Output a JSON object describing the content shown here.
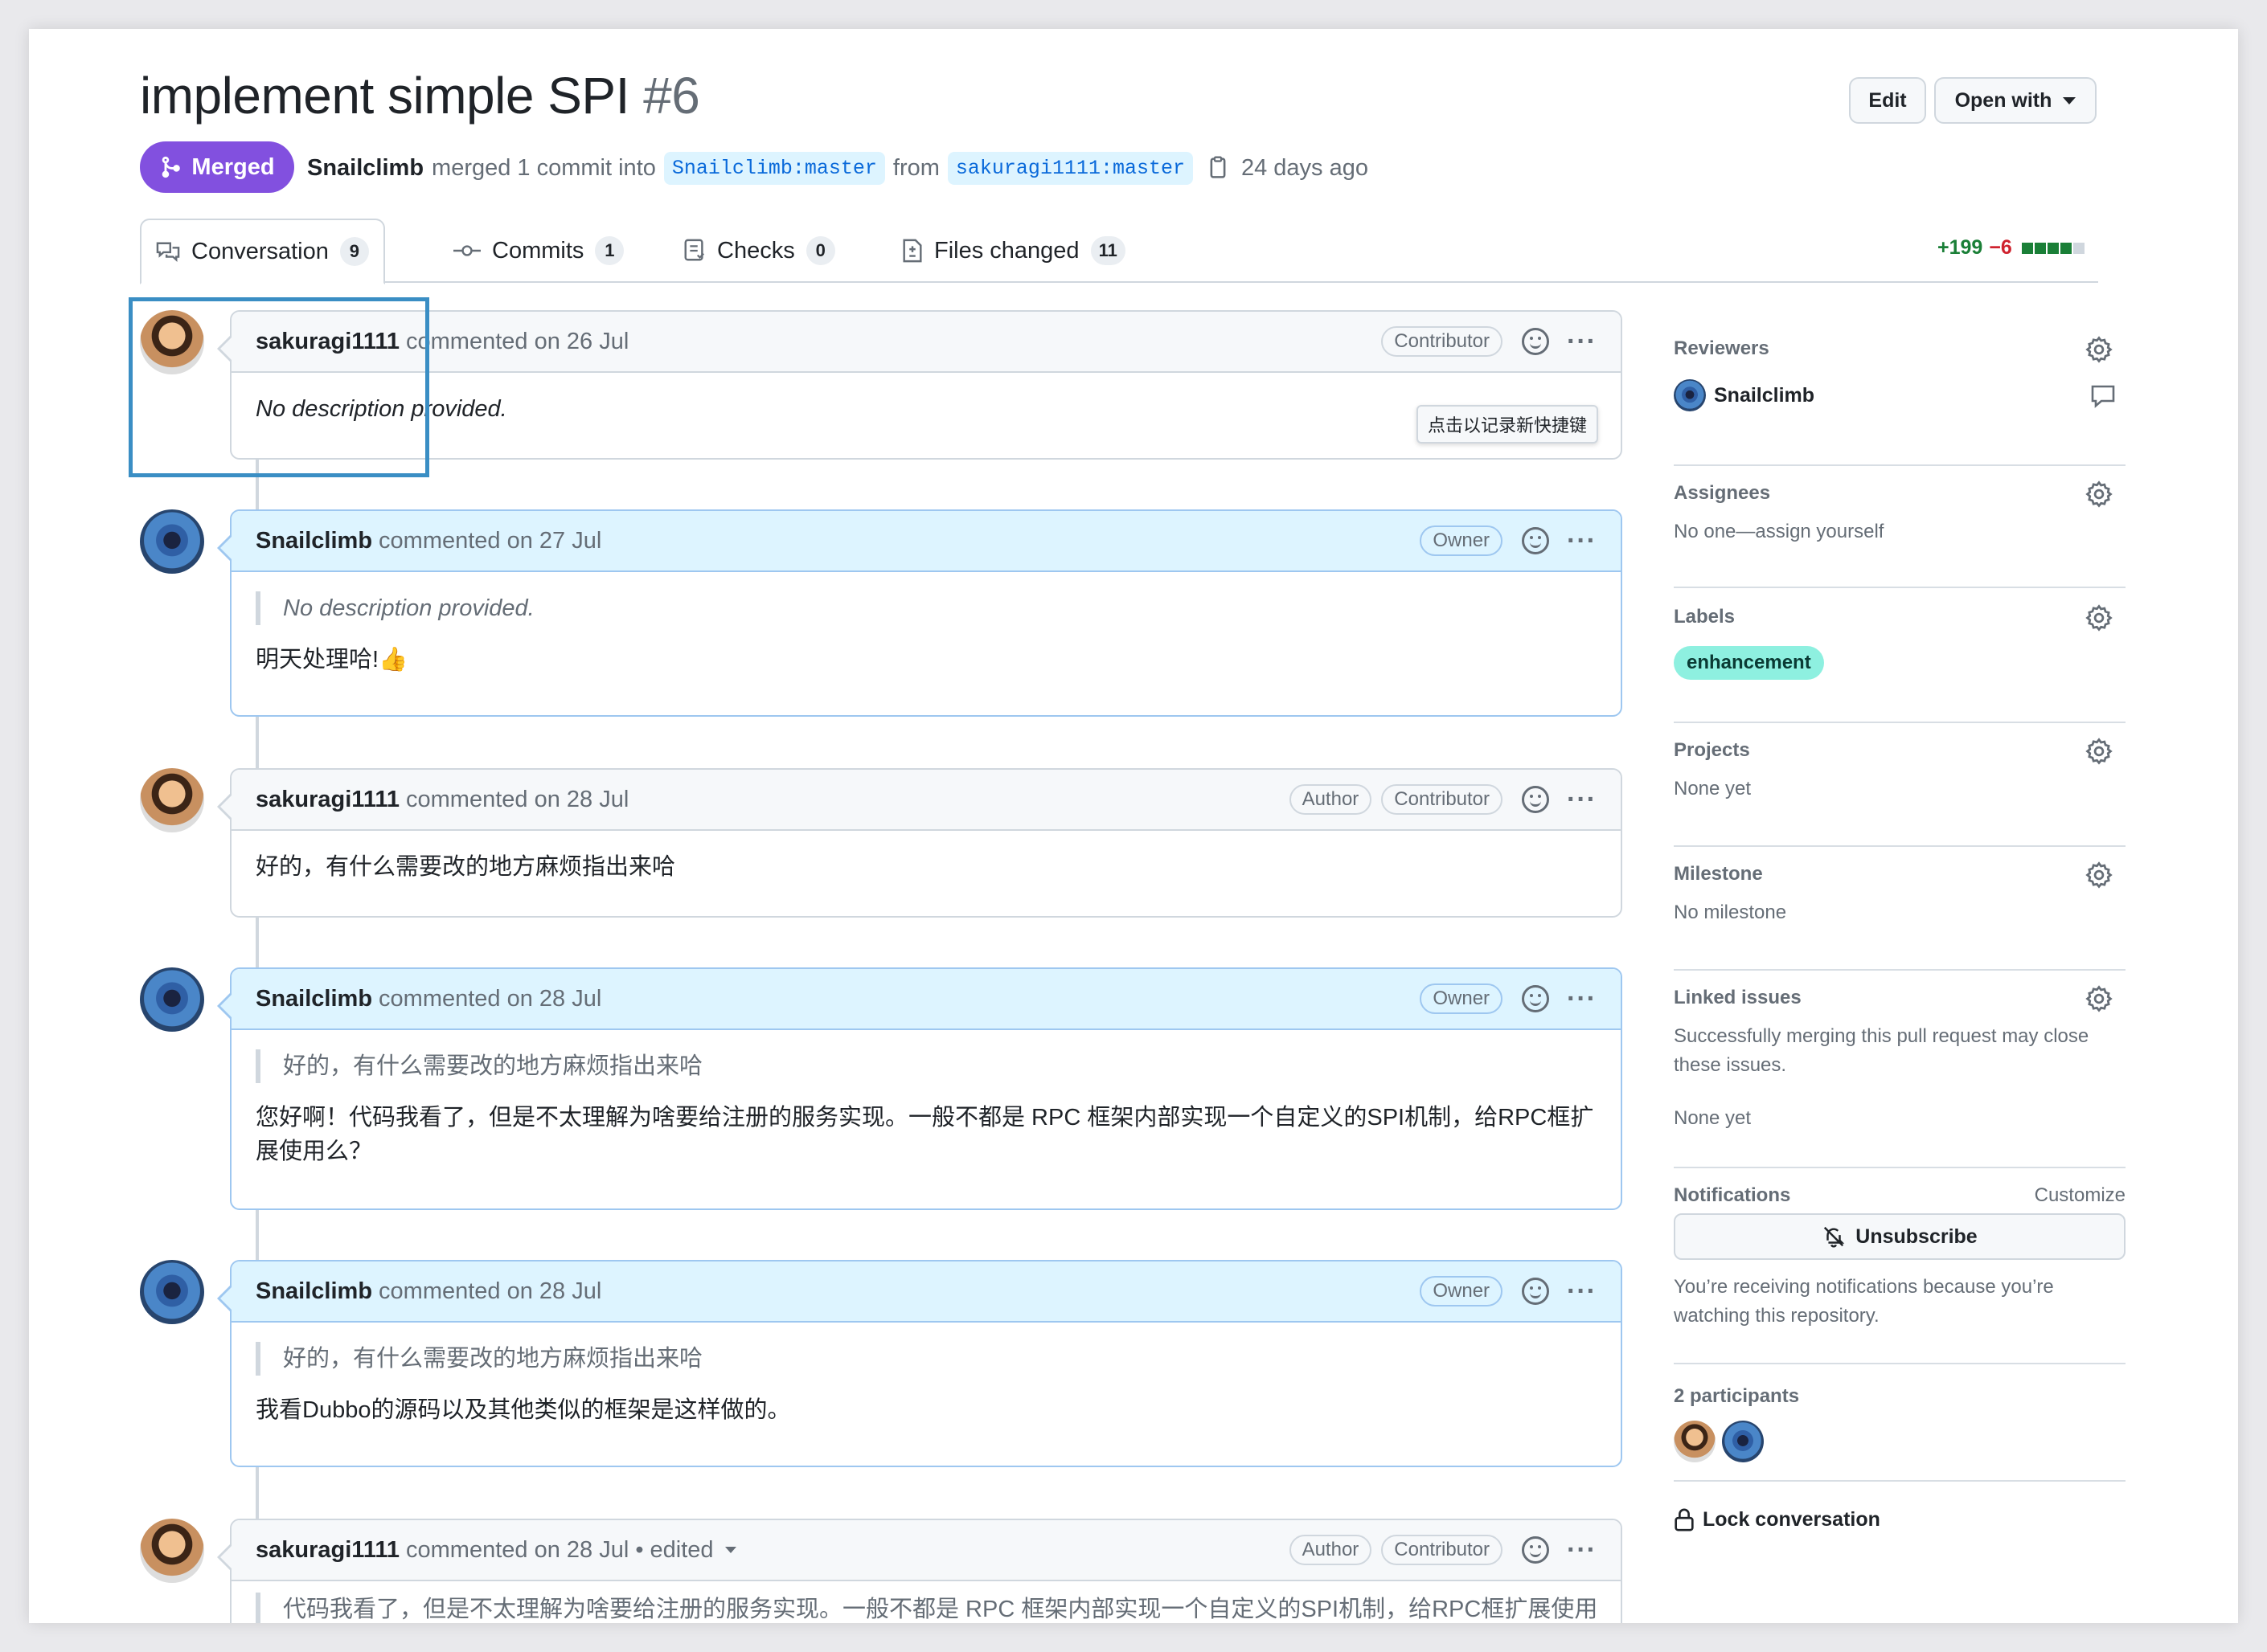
{
  "pr": {
    "title": "implement simple SPI",
    "number": "#6",
    "state": "Merged",
    "merged_by": "Snailclimb",
    "merge_text": "merged 1 commit into",
    "base_branch": "Snailclimb:master",
    "from_word": "from",
    "head_branch": "sakuragi1111:master",
    "time": "24 days ago"
  },
  "header": {
    "edit_label": "Edit",
    "open_with_label": "Open with"
  },
  "tabs": [
    {
      "label": "Conversation",
      "count": "9",
      "icon": "comment-discussion-icon"
    },
    {
      "label": "Commits",
      "count": "1",
      "icon": "commit-icon"
    },
    {
      "label": "Checks",
      "count": "0",
      "icon": "checklist-icon"
    },
    {
      "label": "Files changed",
      "count": "11",
      "icon": "file-diff-icon"
    }
  ],
  "diffstat": {
    "additions": "+199",
    "deletions": "−6"
  },
  "tooltip": "点击以记录新快捷键",
  "comments": [
    {
      "author": "sakuragi1111",
      "action": "commented on 26 Jul",
      "roles": [
        "Contributor"
      ],
      "body": "No description provided."
    },
    {
      "author": "Snailclimb",
      "action": "commented on 27 Jul",
      "roles": [
        "Owner"
      ],
      "quote": "No description provided.",
      "body": "明天处理哈!👍"
    },
    {
      "author": "sakuragi1111",
      "action": "commented on 28 Jul",
      "roles": [
        "Author",
        "Contributor"
      ],
      "body": "好的，有什么需要改的地方麻烦指出来哈"
    },
    {
      "author": "Snailclimb",
      "action": "commented on 28 Jul",
      "roles": [
        "Owner"
      ],
      "quote": "好的，有什么需要改的地方麻烦指出来哈",
      "body": "您好啊！代码我看了，但是不太理解为啥要给注册的服务实现。一般不都是 RPC 框架内部实现一个自定义的SPI机制，给RPC框扩展使用么？"
    },
    {
      "author": "Snailclimb",
      "action": "commented on 28 Jul",
      "roles": [
        "Owner"
      ],
      "quote": "好的，有什么需要改的地方麻烦指出来哈",
      "body": "我看Dubbo的源码以及其他类似的框架是这样做的。"
    },
    {
      "author": "sakuragi1111",
      "action": "commented on 28 Jul • edited",
      "roles": [
        "Author",
        "Contributor"
      ],
      "body": "代码我看了，但是不太理解为啥要给注册的服务实现。一般不都是 RPC 框架内部实现一个自定义的SPI机制，给RPC框扩展使用"
    }
  ],
  "sidebar": {
    "reviewers": {
      "heading": "Reviewers",
      "name": "Snailclimb"
    },
    "assignees": {
      "heading": "Assignees",
      "text": "No one—assign yourself"
    },
    "labels": {
      "heading": "Labels",
      "label": "enhancement",
      "label_color": "#8ef0e0"
    },
    "projects": {
      "heading": "Projects",
      "text": "None yet"
    },
    "milestone": {
      "heading": "Milestone",
      "text": "No milestone"
    },
    "linked_issues": {
      "heading": "Linked issues",
      "text": "Successfully merging this pull request may close these issues.",
      "none": "None yet"
    },
    "notifications": {
      "heading": "Notifications",
      "customize": "Customize",
      "button": "Unsubscribe",
      "reason": "You’re receiving notifications because you’re watching this repository."
    },
    "participants": {
      "heading": "2 participants"
    },
    "lock": "Lock conversation"
  },
  "colors": {
    "merged": "#8250df",
    "link": "#0969da",
    "additions": "#1a7f37",
    "deletions": "#cf222e",
    "highlight_box": "#3a8ec4"
  }
}
